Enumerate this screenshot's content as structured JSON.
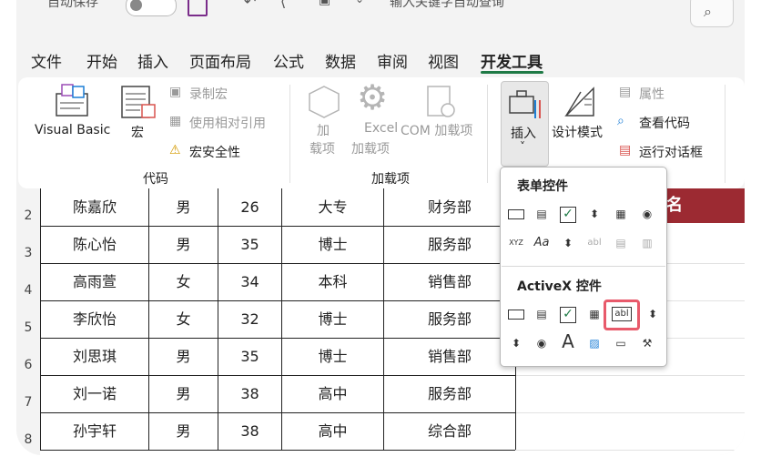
{
  "titlebar": {
    "autosave": "自动保存",
    "toggle": "关",
    "search_hint": "输入关键字自动查询"
  },
  "menu": {
    "tabs": [
      "文件",
      "开始",
      "插入",
      "页面布局",
      "公式",
      "数据",
      "审阅",
      "视图",
      "开发工具"
    ],
    "active": "开发工具"
  },
  "ribbon": {
    "code": {
      "visual_basic": "Visual Basic",
      "macros": "宏",
      "record_macro": "录制宏",
      "relative_refs": "使用相对引用",
      "macro_security": "宏安全性",
      "label": "代码"
    },
    "addins": {
      "addins_l1": "加",
      "addins_l2": "载项",
      "excel_l1": "Excel",
      "excel_l2": "加载项",
      "com": "COM 加载项",
      "label": "加载项"
    },
    "controls": {
      "insert": "插入",
      "insert_caret": "˅",
      "design_mode": "设计模式",
      "properties": "属性",
      "view_code": "查看代码",
      "run_dialog": "运行对话框"
    }
  },
  "sheet": {
    "header_partial": "名",
    "row_numbers": [
      "2",
      "3",
      "4",
      "5",
      "6",
      "7",
      "8"
    ],
    "rows": [
      [
        "陈嘉欣",
        "男",
        "26",
        "大专",
        "财务部"
      ],
      [
        "陈心怡",
        "男",
        "35",
        "博士",
        "服务部"
      ],
      [
        "高雨萱",
        "女",
        "34",
        "本科",
        "销售部"
      ],
      [
        "李欣怡",
        "女",
        "32",
        "博士",
        "服务部"
      ],
      [
        "刘思琪",
        "男",
        "35",
        "博士",
        "销售部"
      ],
      [
        "刘一诺",
        "男",
        "38",
        "高中",
        "服务部"
      ],
      [
        "孙宇轩",
        "男",
        "38",
        "高中",
        "综合部"
      ]
    ]
  },
  "popup": {
    "form_controls_title": "表单控件",
    "activex_title": "ActiveX 控件",
    "form_controls": [
      "button",
      "combo-box",
      "check-box",
      "spin-button",
      "list-box",
      "option-button",
      "group-box",
      "label",
      "scroll-bar",
      "text-field",
      "combo-list-edit",
      "combo-drop-down"
    ],
    "form_label_text": "Aa",
    "form_group_text": "XYZ",
    "textbox_text": "abl",
    "activex_controls": [
      "command-button",
      "combo-box",
      "check-box",
      "list-box",
      "text-box",
      "scroll-bar",
      "spin-button",
      "option-button",
      "label",
      "image",
      "toggle-button",
      "more-controls"
    ],
    "activex_label_text": "A",
    "highlighted": "text-box"
  },
  "colors": {
    "accent": "#1f7a46",
    "header_red": "#9c2a32",
    "highlight": "#e85a6b",
    "check_green": "#1f7a46"
  }
}
